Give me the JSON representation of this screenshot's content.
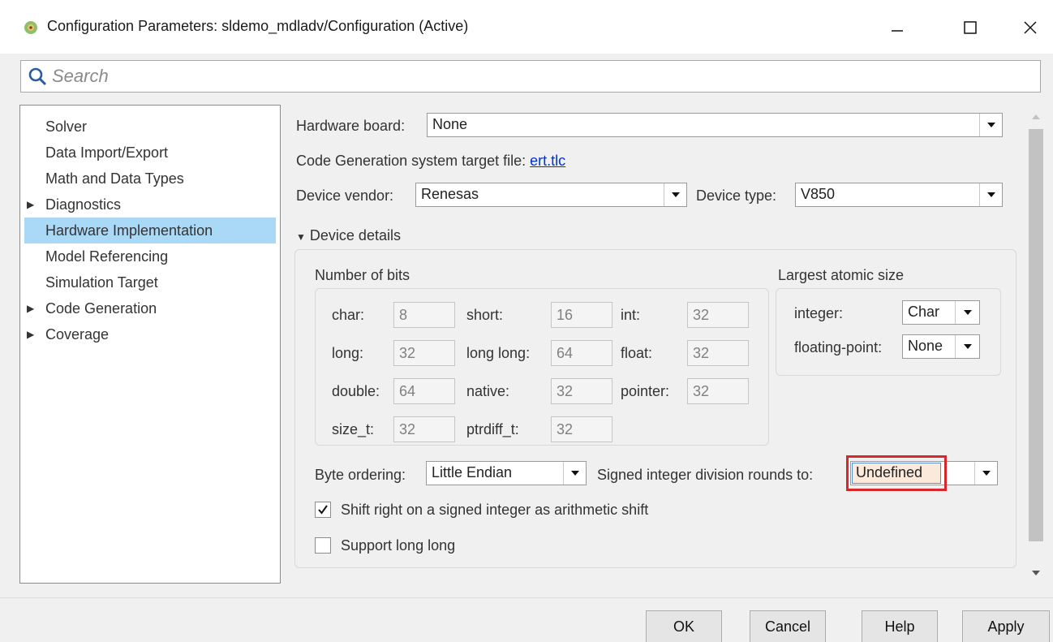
{
  "window": {
    "title": "Configuration Parameters: sldemo_mdladv/Configuration (Active)",
    "minimize_label": "—",
    "maximize_label": "☐",
    "close_label": "✕"
  },
  "search": {
    "placeholder": "Search"
  },
  "sidebar": {
    "items": [
      {
        "label": "Solver",
        "expandable": false
      },
      {
        "label": "Data Import/Export",
        "expandable": false
      },
      {
        "label": "Math and Data Types",
        "expandable": false
      },
      {
        "label": "Diagnostics",
        "expandable": true
      },
      {
        "label": "Hardware Implementation",
        "expandable": false,
        "selected": true
      },
      {
        "label": "Model Referencing",
        "expandable": false
      },
      {
        "label": "Simulation Target",
        "expandable": false
      },
      {
        "label": "Code Generation",
        "expandable": true
      },
      {
        "label": "Coverage",
        "expandable": true
      }
    ]
  },
  "main": {
    "hardware_board_label": "Hardware board:",
    "hardware_board_value": "None",
    "target_file_label": "Code Generation system target file:",
    "target_file_link": "ert.tlc",
    "device_vendor_label": "Device vendor:",
    "device_vendor_value": "Renesas",
    "device_type_label": "Device type:",
    "device_type_value": "V850",
    "device_details_label": "Device details",
    "number_of_bits": {
      "title": "Number of bits",
      "char_label": "char:",
      "char": "8",
      "short_label": "short:",
      "short": "16",
      "int_label": "int:",
      "int": "32",
      "long_label": "long:",
      "long": "32",
      "longlong_label": "long long:",
      "longlong": "64",
      "float_label": "float:",
      "float": "32",
      "double_label": "double:",
      "double": "64",
      "native_label": "native:",
      "native": "32",
      "pointer_label": "pointer:",
      "pointer": "32",
      "sizet_label": "size_t:",
      "sizet": "32",
      "ptrdiff_label": "ptrdiff_t:",
      "ptrdiff": "32"
    },
    "atomic": {
      "title": "Largest atomic size",
      "integer_label": "integer:",
      "integer_value": "Char",
      "fp_label": "floating-point:",
      "fp_value": "None"
    },
    "byte_ordering_label": "Byte ordering:",
    "byte_ordering_value": "Little Endian",
    "signed_div_label": "Signed integer division rounds to:",
    "signed_div_value": "Undefined",
    "shift_right_label": "Shift right on a signed integer as arithmetic shift",
    "shift_right_checked": true,
    "support_long_long_label": "Support long long",
    "support_long_long_checked": false
  },
  "footer": {
    "ok": "OK",
    "cancel": "Cancel",
    "help": "Help",
    "apply": "Apply"
  },
  "colors": {
    "selection": "#aad8f7",
    "highlight_frame": "#d9262b",
    "link": "#0033cc"
  }
}
